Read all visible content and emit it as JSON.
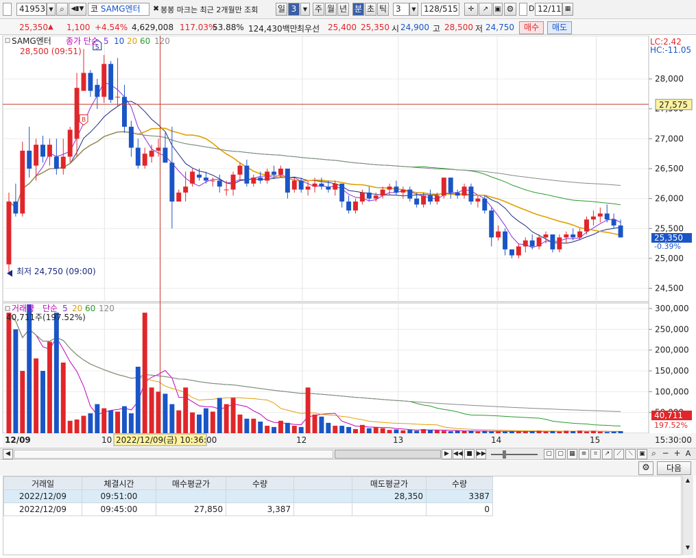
{
  "toolbar": {
    "code": "419530",
    "market": "코",
    "stock_name": "SAMG엔터",
    "notice": "봉봉 마크는 최근 2개월만 조회",
    "period_tabs": [
      "일",
      "3",
      "주",
      "월",
      "년",
      "분",
      "초",
      "틱"
    ],
    "interval": "3",
    "count": "128/515",
    "d_label": "D",
    "date": "12/11"
  },
  "price_bar": {
    "price": "25,350",
    "arrow": "▲",
    "change": "1,100",
    "rate": "+4.54%",
    "volume": "4,629,008",
    "vol_ratio": "117.03%",
    "turnover": "53.88%",
    "amount": "124,430백만",
    "best_ask_label": "최우선",
    "best_ask": "25,400",
    "best_bid": "25,350",
    "open_label": "시",
    "open": "24,900",
    "high_label": "고",
    "high": "28,500",
    "low_label": "저",
    "low": "24,750",
    "buy_button": "매수",
    "sell_button": "매도"
  },
  "price_chart": {
    "legend_name": "SAMG엔터",
    "legend_ma": "종가 단순",
    "ma_periods": [
      "5",
      "10",
      "20",
      "60",
      "120"
    ],
    "high_marker": "28,500 (09:51)",
    "low_marker": "최저 24,750 (09:00)",
    "lc": "LC:2.42",
    "hc": "HC:-11.05",
    "ref_line_value": "27,575",
    "current_value": "25,350",
    "current_rate": "-0.39%",
    "buy_signal": "B",
    "sell_signal": "S"
  },
  "volume_chart": {
    "legend_name": "거래량",
    "legend_ma": "단순",
    "ma_periods": [
      "5",
      "20",
      "60",
      "120"
    ],
    "value_note": "40,711주(197.52%)",
    "current_value": "40,711",
    "current_rate": "197.52%"
  },
  "time_axis": {
    "labels": [
      "12/09",
      "10",
      "12",
      "13",
      "14",
      "15"
    ],
    "cursor_label": "2022/12/09(금) 10:36:00",
    "right_label": "15:30:00"
  },
  "grid_bar": {
    "next_button": "다음"
  },
  "trade_table": {
    "headers": [
      "거래일",
      "체결시간",
      "매수평균가",
      "수량",
      "",
      "매도평균가",
      "수량"
    ],
    "rows": [
      [
        "2022/12/09",
        "09:51:00",
        "",
        "",
        "",
        "28,350",
        "3387"
      ],
      [
        "2022/12/09",
        "09:45:00",
        "27,850",
        "3,387",
        "",
        "",
        "0"
      ]
    ]
  },
  "chart_data": {
    "type": "candlestick",
    "title": "",
    "price_axis": {
      "ticks": [
        28000,
        27500,
        27000,
        26500,
        26000,
        25500,
        25000,
        24500
      ],
      "range": [
        24300,
        28700
      ]
    },
    "volume_axis": {
      "ticks": [
        300000,
        250000,
        200000,
        150000,
        100000,
        50000
      ],
      "range": [
        0,
        310000
      ]
    },
    "candles": [
      [
        24900,
        26100,
        24750,
        25950
      ],
      [
        25950,
        26250,
        25700,
        25750
      ],
      [
        25750,
        26950,
        25700,
        26800
      ],
      [
        26800,
        27200,
        26350,
        26500
      ],
      [
        26550,
        27000,
        26300,
        26900
      ],
      [
        26900,
        27050,
        26600,
        26700
      ],
      [
        26700,
        27000,
        26550,
        26900
      ],
      [
        26700,
        27000,
        26400,
        26500
      ],
      [
        26500,
        27000,
        26400,
        26700
      ],
      [
        26700,
        27200,
        26600,
        27150
      ],
      [
        27000,
        28100,
        26700,
        27850
      ],
      [
        27800,
        28500,
        27800,
        28100
      ],
      [
        28100,
        28150,
        27700,
        27800
      ],
      [
        27900,
        28000,
        27500,
        27700
      ],
      [
        27700,
        28400,
        27600,
        28250
      ],
      [
        28250,
        28300,
        27600,
        27650
      ],
      [
        27700,
        28350,
        27550,
        27700
      ],
      [
        27700,
        27900,
        27100,
        27200
      ],
      [
        27200,
        27300,
        26700,
        26850
      ],
      [
        26850,
        27000,
        26500,
        26550
      ],
      [
        26550,
        26850,
        26500,
        26750
      ],
      [
        26700,
        26900,
        26600,
        26800
      ],
      [
        26800,
        27000,
        26700,
        26850
      ],
      [
        26850,
        27100,
        26600,
        26600
      ],
      [
        26600,
        27200,
        25500,
        25950
      ],
      [
        25950,
        26150,
        25950,
        26100
      ],
      [
        26100,
        26450,
        25950,
        26200
      ],
      [
        26250,
        26500,
        26200,
        26450
      ],
      [
        26400,
        26500,
        26300,
        26350
      ],
      [
        26350,
        26450,
        26250,
        26300
      ],
      [
        26300,
        26350,
        26200,
        26300
      ],
      [
        26300,
        26400,
        26100,
        26200
      ],
      [
        26150,
        26300,
        26050,
        26150
      ],
      [
        26150,
        26450,
        26050,
        26400
      ],
      [
        26400,
        26600,
        26300,
        26550
      ],
      [
        26550,
        26650,
        26200,
        26250
      ],
      [
        26250,
        26400,
        26200,
        26350
      ],
      [
        26350,
        26450,
        26250,
        26300
      ],
      [
        26300,
        26500,
        26250,
        26450
      ],
      [
        26450,
        26550,
        26350,
        26400
      ],
      [
        26400,
        26550,
        26350,
        26500
      ],
      [
        26500,
        26500,
        26000,
        26100
      ],
      [
        26150,
        26350,
        26100,
        26300
      ],
      [
        26300,
        26350,
        26100,
        26150
      ],
      [
        26150,
        26300,
        26050,
        26200
      ],
      [
        26200,
        26350,
        26100,
        26250
      ],
      [
        26250,
        26350,
        26150,
        26200
      ],
      [
        26200,
        26300,
        26100,
        26150
      ],
      [
        26150,
        26300,
        26050,
        26250
      ],
      [
        26250,
        26250,
        25850,
        25950
      ],
      [
        25950,
        26050,
        25750,
        25800
      ],
      [
        25800,
        26000,
        25750,
        25950
      ],
      [
        25950,
        26150,
        25900,
        26100
      ],
      [
        26100,
        26200,
        25950,
        26000
      ],
      [
        26000,
        26100,
        25950,
        26050
      ],
      [
        26050,
        26200,
        26000,
        26150
      ],
      [
        26150,
        26250,
        26050,
        26200
      ],
      [
        26200,
        26300,
        26050,
        26100
      ],
      [
        26100,
        26200,
        26000,
        26150
      ],
      [
        26150,
        26200,
        25950,
        26000
      ],
      [
        26000,
        26100,
        25850,
        25900
      ],
      [
        25900,
        26100,
        25850,
        26050
      ],
      [
        26050,
        26150,
        25900,
        25950
      ],
      [
        25950,
        26100,
        25900,
        26050
      ],
      [
        26050,
        26350,
        26000,
        26350
      ],
      [
        26350,
        26350,
        26000,
        26100
      ],
      [
        26100,
        26150,
        26000,
        26050
      ],
      [
        26050,
        26250,
        26000,
        26200
      ],
      [
        26200,
        26250,
        25900,
        25950
      ],
      [
        25950,
        26050,
        25850,
        26000
      ],
      [
        26000,
        26050,
        25750,
        25800
      ],
      [
        25800,
        25850,
        25200,
        25350
      ],
      [
        25350,
        25550,
        25300,
        25450
      ],
      [
        25450,
        25500,
        25050,
        25150
      ],
      [
        25150,
        25150,
        25000,
        25050
      ],
      [
        25050,
        25250,
        25000,
        25200
      ],
      [
        25200,
        25350,
        25100,
        25300
      ],
      [
        25300,
        25400,
        25150,
        25200
      ],
      [
        25200,
        25400,
        25150,
        25350
      ],
      [
        25350,
        25450,
        25250,
        25400
      ],
      [
        25400,
        25400,
        25100,
        25150
      ],
      [
        25150,
        25400,
        25100,
        25350
      ],
      [
        25350,
        25450,
        25250,
        25400
      ],
      [
        25400,
        25500,
        25300,
        25350
      ],
      [
        25350,
        25500,
        25300,
        25450
      ],
      [
        25450,
        25700,
        25400,
        25650
      ],
      [
        25650,
        25800,
        25550,
        25700
      ],
      [
        25700,
        25850,
        25600,
        25750
      ],
      [
        25750,
        25900,
        25600,
        25650
      ],
      [
        25650,
        25750,
        25500,
        25550
      ],
      [
        25550,
        25650,
        25350,
        25350
      ]
    ],
    "volumes": [
      290000,
      250000,
      150000,
      310000,
      180000,
      150000,
      220000,
      290000,
      170000,
      30000,
      33000,
      42000,
      48000,
      70000,
      60000,
      55000,
      52000,
      65000,
      48000,
      160000,
      290000,
      110000,
      100000,
      95000,
      70000,
      55000,
      110000,
      50000,
      45000,
      60000,
      52000,
      85000,
      70000,
      85000,
      45000,
      35000,
      35000,
      28000,
      18000,
      15000,
      30000,
      25000,
      18000,
      15000,
      110000,
      45000,
      40000,
      25000,
      18000,
      18000,
      15000,
      10000,
      20000,
      12000,
      15000,
      12000,
      8000,
      9000,
      7000,
      8000,
      6000,
      10000,
      8000,
      7000,
      6000,
      5000,
      6000,
      5000,
      6000,
      4000,
      5000,
      4000,
      5000,
      4000,
      5000,
      4000,
      4000,
      5000,
      6000,
      4000,
      5000,
      4000,
      6000,
      5000,
      6000,
      4000,
      5000,
      4000,
      3000,
      4000,
      5000,
      4000,
      6000,
      5000,
      4000,
      3000,
      5000,
      4000,
      3000,
      5000,
      4000,
      4000,
      3000,
      4000,
      6000,
      5000,
      4000,
      5000,
      4000,
      6000,
      4000,
      3000,
      6000,
      7000,
      8000,
      10000,
      6000,
      5000,
      7000,
      8000,
      40711
    ],
    "ref_line": 27575,
    "current": 25350
  }
}
